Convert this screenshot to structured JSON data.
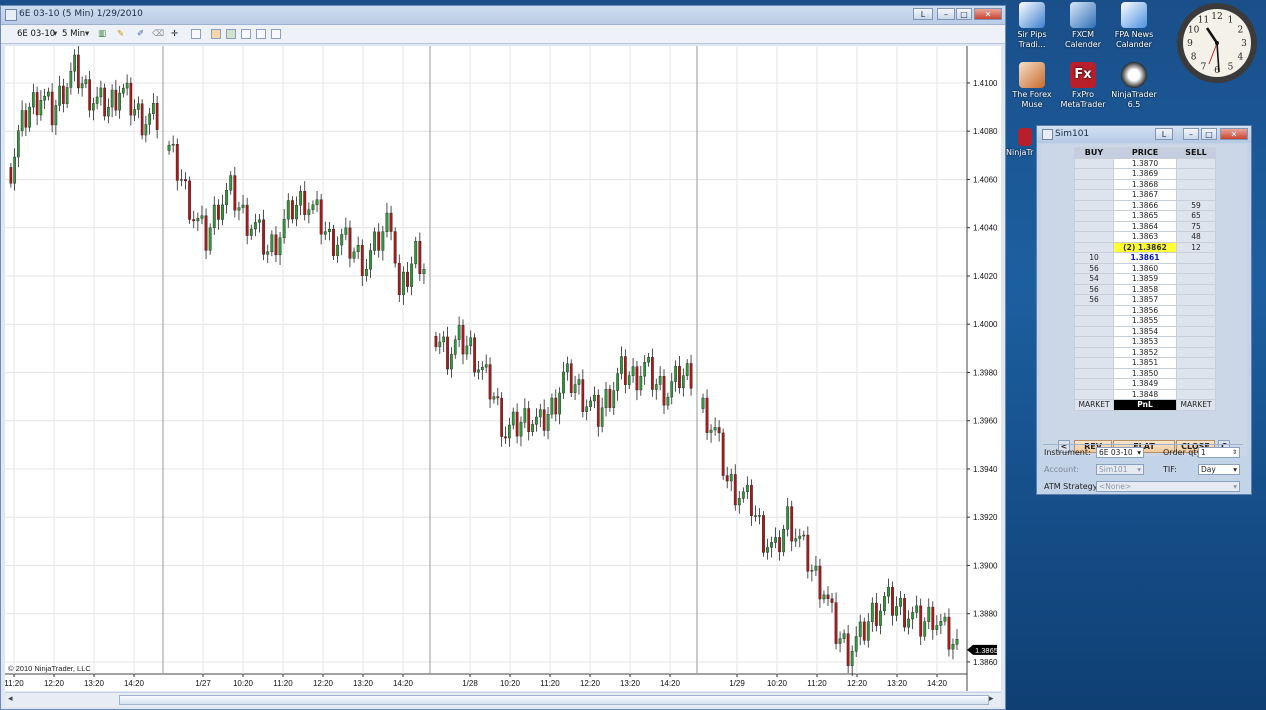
{
  "chart_window": {
    "title": "6E 03-10 (5 Min)  1/29/2010",
    "link_label": "L",
    "toolbar": {
      "instrument": "6E 03-10",
      "interval": "5 Min"
    },
    "copyright": "© 2010 NinjaTrader, LLC"
  },
  "chart_data": {
    "type": "candlestick",
    "instrument": "6E 03-10",
    "interval": "5 Min",
    "y_ticks": [
      "1.4100",
      "1.4080",
      "1.4060",
      "1.4040",
      "1.4020",
      "1.4000",
      "1.3980",
      "1.3960",
      "1.3940",
      "1.3920",
      "1.3900",
      "1.3880",
      "1.3860"
    ],
    "ylim": [
      1.3855,
      1.4112
    ],
    "last_price": "1.3865",
    "x_ticks": [
      "11:20",
      "12:20",
      "13:20",
      "14:20",
      "1/27",
      "10:20",
      "11:20",
      "12:20",
      "13:20",
      "14:20",
      "1/28",
      "10:20",
      "11:20",
      "12:20",
      "13:20",
      "14:20",
      "1/29",
      "10:20",
      "11:20",
      "12:20",
      "13:20",
      "14:20"
    ],
    "sessions": [
      {
        "date": "",
        "close_path": [
          [
            0,
            1.4065
          ],
          [
            2,
            1.4078
          ],
          [
            5,
            1.409
          ],
          [
            8,
            1.4095
          ],
          [
            11,
            1.4087
          ],
          [
            14,
            1.4098
          ],
          [
            17,
            1.4105
          ],
          [
            20,
            1.4097
          ],
          [
            23,
            1.4092
          ],
          [
            26,
            1.409
          ],
          [
            29,
            1.4098
          ],
          [
            32,
            1.4091
          ],
          [
            35,
            1.4085
          ],
          [
            39,
            1.4085
          ]
        ]
      },
      {
        "date": "1/27",
        "close_path": [
          [
            0,
            1.4072
          ],
          [
            3,
            1.406
          ],
          [
            6,
            1.4045
          ],
          [
            9,
            1.4035
          ],
          [
            12,
            1.405
          ],
          [
            15,
            1.4055
          ],
          [
            18,
            1.4045
          ],
          [
            21,
            1.404
          ],
          [
            24,
            1.403
          ],
          [
            27,
            1.4038
          ],
          [
            30,
            1.4048
          ],
          [
            33,
            1.4052
          ],
          [
            36,
            1.4045
          ],
          [
            39,
            1.4035
          ],
          [
            42,
            1.4035
          ],
          [
            45,
            1.403
          ],
          [
            48,
            1.4025
          ],
          [
            51,
            1.4035
          ],
          [
            54,
            1.4045
          ],
          [
            56,
            1.401
          ],
          [
            58,
            1.402
          ],
          [
            60,
            1.403
          ],
          [
            62,
            1.4025
          ]
        ]
      },
      {
        "date": "1/28",
        "close_path": [
          [
            0,
            1.3995
          ],
          [
            3,
            1.3988
          ],
          [
            6,
            1.3993
          ],
          [
            9,
            1.399
          ],
          [
            12,
            1.398
          ],
          [
            15,
            1.397
          ],
          [
            18,
            1.3955
          ],
          [
            21,
            1.3958
          ],
          [
            24,
            1.3962
          ],
          [
            27,
            1.3958
          ],
          [
            30,
            1.3965
          ],
          [
            33,
            1.3978
          ],
          [
            36,
            1.3975
          ],
          [
            39,
            1.3968
          ],
          [
            42,
            1.3962
          ],
          [
            45,
            1.3972
          ],
          [
            48,
            1.398
          ],
          [
            51,
            1.3978
          ],
          [
            54,
            1.3982
          ],
          [
            57,
            1.3975
          ],
          [
            60,
            1.3972
          ],
          [
            63,
            1.3978
          ],
          [
            66,
            1.398
          ]
        ]
      },
      {
        "date": "1/29",
        "close_path": [
          [
            0,
            1.3965
          ],
          [
            3,
            1.3955
          ],
          [
            6,
            1.3935
          ],
          [
            9,
            1.393
          ],
          [
            12,
            1.3925
          ],
          [
            15,
            1.3912
          ],
          [
            18,
            1.3905
          ],
          [
            21,
            1.392
          ],
          [
            24,
            1.391
          ],
          [
            27,
            1.3898
          ],
          [
            30,
            1.389
          ],
          [
            33,
            1.3872
          ],
          [
            36,
            1.3865
          ],
          [
            39,
            1.387
          ],
          [
            42,
            1.388
          ],
          [
            45,
            1.3885
          ],
          [
            48,
            1.3883
          ],
          [
            51,
            1.388
          ],
          [
            54,
            1.3875
          ],
          [
            57,
            1.388
          ],
          [
            60,
            1.3872
          ],
          [
            63,
            1.3865
          ]
        ]
      }
    ]
  },
  "desktop_icons": [
    {
      "label": "Sir Pips Tradi...",
      "color": "#3d7fd0"
    },
    {
      "label": "FXCM Calender",
      "color": "#2e6fb8"
    },
    {
      "label": "FPA News Calander",
      "color": "#4a90e0"
    },
    {
      "label": "The Forex Muse",
      "color": "#c86a2b"
    },
    {
      "label": "FxPro MetaTrader",
      "color": "#b81f2a"
    },
    {
      "label": "NinjaTrader 6.5",
      "color": "#2a2a2a"
    },
    {
      "label": "NinjaTr",
      "color": "#2a2a2a"
    }
  ],
  "dom": {
    "title": "Sim101",
    "link_label": "L",
    "headers": {
      "buy": "BUY",
      "price": "PRICE",
      "sell": "SELL"
    },
    "rows": [
      {
        "buy": "",
        "price": "1.3870",
        "sell": ""
      },
      {
        "buy": "",
        "price": "1.3869",
        "sell": ""
      },
      {
        "buy": "",
        "price": "1.3868",
        "sell": ""
      },
      {
        "buy": "",
        "price": "1.3867",
        "sell": ""
      },
      {
        "buy": "",
        "price": "1.3866",
        "sell": "59"
      },
      {
        "buy": "",
        "price": "1.3865",
        "sell": "65"
      },
      {
        "buy": "",
        "price": "1.3864",
        "sell": "75"
      },
      {
        "buy": "",
        "price": "1.3863",
        "sell": "48"
      },
      {
        "buy": "",
        "price": "(2) 1.3862",
        "sell": "12",
        "kind": "ask"
      },
      {
        "buy": "10",
        "price": "1.3861",
        "sell": "",
        "kind": "bid"
      },
      {
        "buy": "56",
        "price": "1.3860",
        "sell": ""
      },
      {
        "buy": "54",
        "price": "1.3859",
        "sell": ""
      },
      {
        "buy": "56",
        "price": "1.3858",
        "sell": ""
      },
      {
        "buy": "56",
        "price": "1.3857",
        "sell": ""
      },
      {
        "buy": "",
        "price": "1.3856",
        "sell": ""
      },
      {
        "buy": "",
        "price": "1.3855",
        "sell": ""
      },
      {
        "buy": "",
        "price": "1.3854",
        "sell": ""
      },
      {
        "buy": "",
        "price": "1.3853",
        "sell": ""
      },
      {
        "buy": "",
        "price": "1.3852",
        "sell": ""
      },
      {
        "buy": "",
        "price": "1.3851",
        "sell": ""
      },
      {
        "buy": "",
        "price": "1.3850",
        "sell": ""
      },
      {
        "buy": "",
        "price": "1.3849",
        "sell": ""
      },
      {
        "buy": "",
        "price": "1.3848",
        "sell": ""
      }
    ],
    "footer": {
      "buy": "MARKET",
      "price": "PnL",
      "sell": "MARKET"
    },
    "buttons": {
      "left": "<",
      "rev": "REV",
      "flat": "FLAT",
      "close": "CLOSE",
      "c": "C"
    },
    "fields": {
      "instrument_label": "Instrument:",
      "instrument_value": "6E 03-10",
      "order_qty_label": "Order qty",
      "order_qty_value": "1",
      "account_label": "Account:",
      "account_value": "Sim101",
      "tif_label": "TIF:",
      "tif_value": "Day",
      "atm_label": "ATM Strategy:",
      "atm_value": "<None>"
    }
  },
  "clock": {
    "numerals": [
      "12",
      "1",
      "2",
      "3",
      "4",
      "5",
      "6",
      "7",
      "8",
      "9",
      "10",
      "11"
    ]
  }
}
